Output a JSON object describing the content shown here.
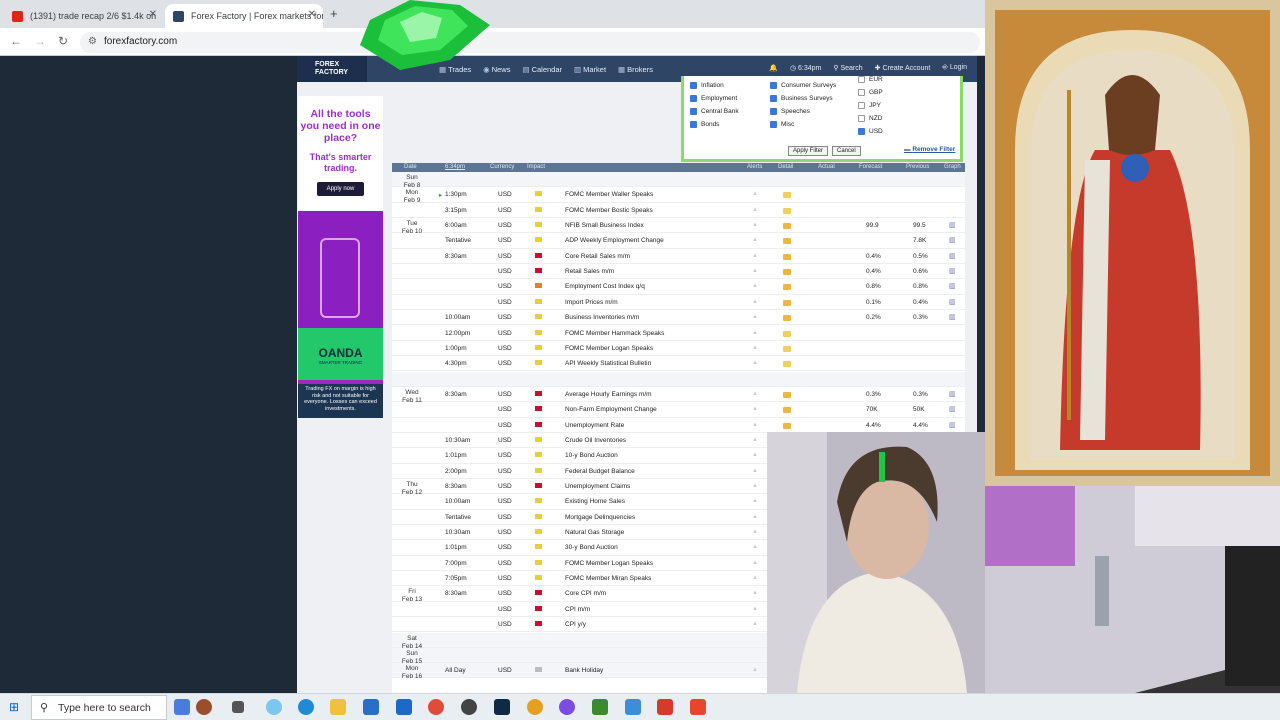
{
  "browser": {
    "tabs": [
      {
        "title": "(1391) trade recap 2/6 $1.4k on",
        "favicon_color": "#e62117"
      },
      {
        "title": "Forex Factory | Forex markets for",
        "favicon_color": "#2f4566"
      }
    ],
    "url": "forexfactory.com"
  },
  "site": {
    "logo": "FOREX FACTORY",
    "nav": [
      "Trades",
      "News",
      "Calendar",
      "Market",
      "Brokers"
    ],
    "time": "6:34pm",
    "search": "Search",
    "create_account": "Create Account",
    "login": "Login"
  },
  "ad": {
    "headline": "All the tools you need in one place?",
    "sub": "That's smarter trading.",
    "button": "Apply now",
    "brand": "OANDA",
    "brand_tag": "SMARTER TRADING",
    "disclaimer": "Trading FX on margin is high risk and not suitable for everyone. Losses can exceed investments."
  },
  "filter": {
    "col1": [
      {
        "label": "Inflation",
        "checked": true
      },
      {
        "label": "Employment",
        "checked": true
      },
      {
        "label": "Central Bank",
        "checked": true
      },
      {
        "label": "Bonds",
        "checked": true
      }
    ],
    "col2": [
      {
        "label": "Consumer Surveys",
        "checked": true
      },
      {
        "label": "Business Surveys",
        "checked": true
      },
      {
        "label": "Speeches",
        "checked": true
      },
      {
        "label": "Misc",
        "checked": true
      }
    ],
    "col3": [
      {
        "label": "EUR",
        "checked": false
      },
      {
        "label": "GBP",
        "checked": false
      },
      {
        "label": "JPY",
        "checked": false
      },
      {
        "label": "NZD",
        "checked": false
      },
      {
        "label": "USD",
        "checked": true
      }
    ],
    "apply": "Apply Filter",
    "cancel": "Cancel",
    "remove": "Remove Filter"
  },
  "calendar": {
    "headers": {
      "date": "Date",
      "time": "6:34pm",
      "currency": "Currency",
      "impact": "Impact",
      "alerts": "Alerts",
      "detail": "Detail",
      "actual": "Actual",
      "forecast": "Forecast",
      "previous": "Previous",
      "graph": "Graph"
    },
    "days": [
      {
        "label": "Sun",
        "date": "Feb 8",
        "row": 0
      },
      {
        "label": "Mon",
        "date": "Feb 9",
        "row": 1
      },
      {
        "label": "Tue",
        "date": "Feb 10",
        "row": 3
      },
      {
        "label": "Wed",
        "date": "Feb 11",
        "row": 14
      },
      {
        "label": "Thu",
        "date": "Feb 12",
        "row": 20
      },
      {
        "label": "Fri",
        "date": "Feb 13",
        "row": 27
      },
      {
        "label": "Sat",
        "date": "Feb 14",
        "row": 30
      },
      {
        "label": "Sun",
        "date": "Feb 15",
        "row": 31
      },
      {
        "label": "Mon",
        "date": "Feb 16",
        "row": 32
      }
    ],
    "events": [
      {
        "time": "",
        "cur": "",
        "impact": "",
        "event": "",
        "forecast": "",
        "previous": "",
        "graph": false
      },
      {
        "time": "1:30pm",
        "cur": "USD",
        "impact": "yellow",
        "event": "FOMC Member Waller Speaks",
        "forecast": "",
        "previous": "",
        "graph": false
      },
      {
        "time": "3:15pm",
        "cur": "USD",
        "impact": "yellow",
        "event": "FOMC Member Bostic Speaks",
        "forecast": "",
        "previous": "",
        "graph": false
      },
      {
        "time": "6:00am",
        "cur": "USD",
        "impact": "yellow",
        "event": "NFIB Small Business Index",
        "forecast": "99.9",
        "previous": "99.5",
        "graph": true
      },
      {
        "time": "Tentative",
        "cur": "USD",
        "impact": "yellow",
        "event": "ADP Weekly Employment Change",
        "forecast": "",
        "previous": "7.8K",
        "graph": true
      },
      {
        "time": "8:30am",
        "cur": "USD",
        "impact": "red",
        "event": "Core Retail Sales m/m",
        "forecast": "0.4%",
        "previous": "0.5%",
        "graph": true
      },
      {
        "time": "",
        "cur": "USD",
        "impact": "red",
        "event": "Retail Sales m/m",
        "forecast": "0.4%",
        "previous": "0.6%",
        "graph": true
      },
      {
        "time": "",
        "cur": "USD",
        "impact": "orange",
        "event": "Employment Cost Index q/q",
        "forecast": "0.8%",
        "previous": "0.8%",
        "graph": true
      },
      {
        "time": "",
        "cur": "USD",
        "impact": "yellow",
        "event": "Import Prices m/m",
        "forecast": "0.1%",
        "previous": "0.4%",
        "graph": true
      },
      {
        "time": "10:00am",
        "cur": "USD",
        "impact": "yellow",
        "event": "Business Inventories m/m",
        "forecast": "0.2%",
        "previous": "0.3%",
        "graph": true
      },
      {
        "time": "12:00pm",
        "cur": "USD",
        "impact": "yellow",
        "event": "FOMC Member Hammack Speaks",
        "forecast": "",
        "previous": "",
        "graph": false
      },
      {
        "time": "1:00pm",
        "cur": "USD",
        "impact": "yellow",
        "event": "FOMC Member Logan Speaks",
        "forecast": "",
        "previous": "",
        "graph": false
      },
      {
        "time": "4:30pm",
        "cur": "USD",
        "impact": "yellow",
        "event": "API Weekly Statistical Bulletin",
        "forecast": "",
        "previous": "",
        "graph": false
      },
      {
        "time": "",
        "cur": "",
        "impact": "",
        "event": "",
        "forecast": "",
        "previous": "",
        "graph": false
      },
      {
        "time": "8:30am",
        "cur": "USD",
        "impact": "red",
        "event": "Average Hourly Earnings m/m",
        "forecast": "0.3%",
        "previous": "0.3%",
        "graph": true
      },
      {
        "time": "",
        "cur": "USD",
        "impact": "red",
        "event": "Non-Farm Employment Change",
        "forecast": "70K",
        "previous": "50K",
        "graph": true
      },
      {
        "time": "",
        "cur": "USD",
        "impact": "red",
        "event": "Unemployment Rate",
        "forecast": "4.4%",
        "previous": "4.4%",
        "graph": true
      },
      {
        "time": "10:30am",
        "cur": "USD",
        "impact": "yellow",
        "event": "Crude Oil Inventories",
        "forecast": "",
        "previous": "",
        "graph": false
      },
      {
        "time": "1:01pm",
        "cur": "USD",
        "impact": "yellow",
        "event": "10-y Bond Auction",
        "forecast": "",
        "previous": "",
        "graph": false
      },
      {
        "time": "2:00pm",
        "cur": "USD",
        "impact": "yellow",
        "event": "Federal Budget Balance",
        "forecast": "",
        "previous": "",
        "graph": false
      },
      {
        "time": "8:30am",
        "cur": "USD",
        "impact": "red",
        "event": "Unemployment Claims",
        "forecast": "",
        "previous": "",
        "graph": false
      },
      {
        "time": "10:00am",
        "cur": "USD",
        "impact": "yellow",
        "event": "Existing Home Sales",
        "forecast": "",
        "previous": "",
        "graph": false
      },
      {
        "time": "Tentative",
        "cur": "USD",
        "impact": "yellow",
        "event": "Mortgage Delinquencies",
        "forecast": "",
        "previous": "",
        "graph": false
      },
      {
        "time": "10:30am",
        "cur": "USD",
        "impact": "yellow",
        "event": "Natural Gas Storage",
        "forecast": "",
        "previous": "",
        "graph": false
      },
      {
        "time": "1:01pm",
        "cur": "USD",
        "impact": "yellow",
        "event": "30-y Bond Auction",
        "forecast": "",
        "previous": "",
        "graph": false
      },
      {
        "time": "7:00pm",
        "cur": "USD",
        "impact": "yellow",
        "event": "FOMC Member Logan Speaks",
        "forecast": "",
        "previous": "",
        "graph": false
      },
      {
        "time": "7:05pm",
        "cur": "USD",
        "impact": "yellow",
        "event": "FOMC Member Miran Speaks",
        "forecast": "",
        "previous": "",
        "graph": false
      },
      {
        "time": "8:30am",
        "cur": "USD",
        "impact": "red",
        "event": "Core CPI m/m",
        "forecast": "",
        "previous": "",
        "graph": false
      },
      {
        "time": "",
        "cur": "USD",
        "impact": "red",
        "event": "CPI m/m",
        "forecast": "",
        "previous": "",
        "graph": false
      },
      {
        "time": "",
        "cur": "USD",
        "impact": "red",
        "event": "CPI y/y",
        "forecast": "",
        "previous": "",
        "graph": false
      },
      {
        "time": "",
        "cur": "",
        "impact": "",
        "event": "",
        "forecast": "",
        "previous": "",
        "graph": false
      },
      {
        "time": "",
        "cur": "",
        "impact": "",
        "event": "",
        "forecast": "",
        "previous": "",
        "graph": false
      },
      {
        "time": "All Day",
        "cur": "USD",
        "impact": "gray",
        "event": "Bank Holiday",
        "forecast": "",
        "previous": "",
        "graph": false
      }
    ],
    "impact_colors": {
      "yellow": "#e8cf3a",
      "red": "#c8102e",
      "orange": "#e57f2b",
      "gray": "#bbbbbb"
    }
  },
  "taskbar": {
    "search_placeholder": "Type here to search"
  }
}
